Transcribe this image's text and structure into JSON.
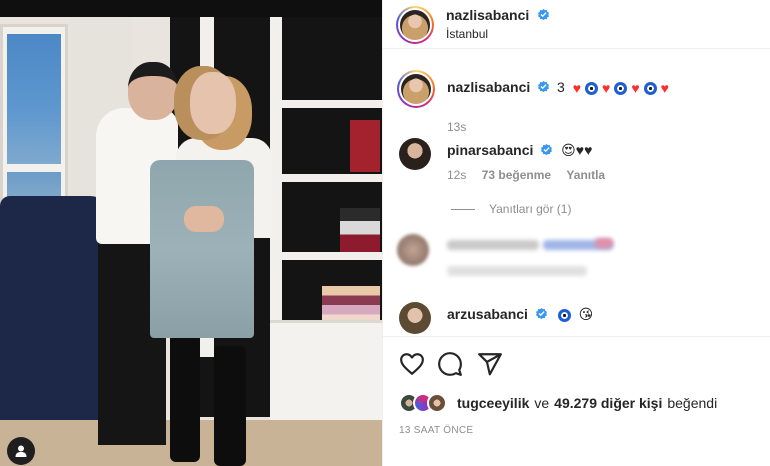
{
  "post": {
    "author": "nazlisabanci",
    "location": "İstanbul"
  },
  "caption": {
    "username": "nazlisabanci",
    "count": "3",
    "time": "13s"
  },
  "comments": [
    {
      "username": "pinarsabanci",
      "emoji_text": "😍♥♥",
      "time": "12s",
      "likes": "73 beğenme",
      "reply_label": "Yanıtla"
    },
    {
      "username": "arzusabanci",
      "emoji_text": "😘"
    }
  ],
  "view_replies": "Yanıtları gör (1)",
  "likes": {
    "first_liker": "tugceeyilik",
    "connector": "ve",
    "others": "49.279 diğer kişi",
    "suffix": "beğendi"
  },
  "time_ago": "13 SAAT ÖNCE",
  "colors": {
    "verified": "#3897f0",
    "heart": "#ff2d2d",
    "muted": "#8e8e8e"
  },
  "icons": [
    "heart-icon",
    "comment-icon",
    "share-icon",
    "user-tag-icon",
    "verified-icon",
    "nazar-eye-icon"
  ]
}
